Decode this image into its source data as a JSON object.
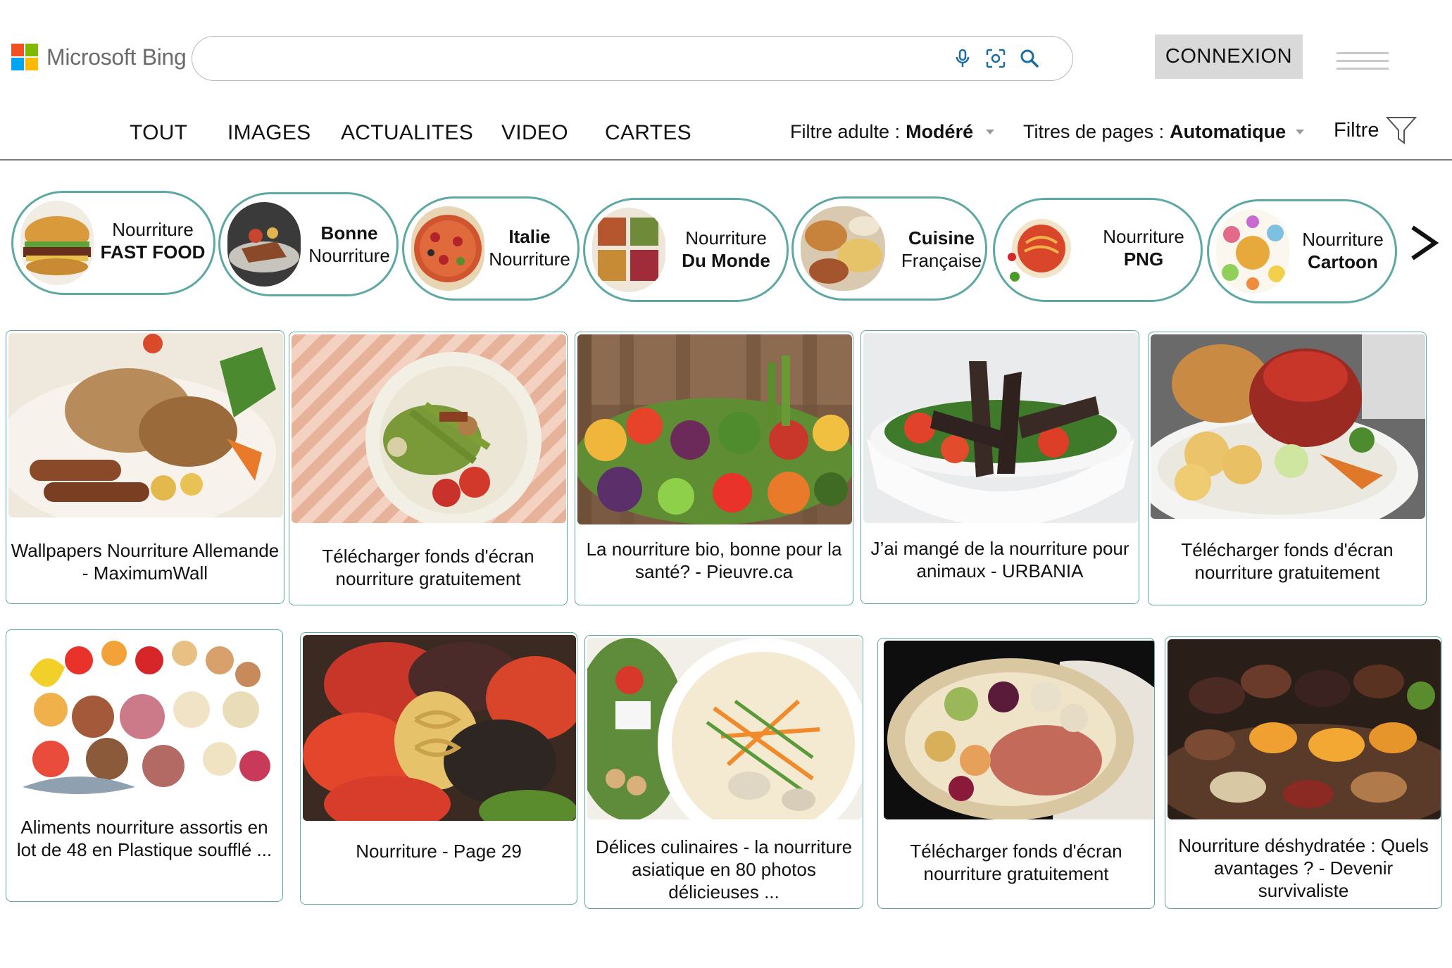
{
  "brand": {
    "logo_text": "Microsoft Bing",
    "colors": {
      "red": "#f25022",
      "green": "#7fba00",
      "blue": "#00a4ef",
      "yellow": "#ffb900"
    }
  },
  "search": {
    "query": "",
    "placeholder": "",
    "mic_icon": "microphone-icon",
    "visual_icon": "visual-search-icon",
    "search_icon": "search-icon",
    "icon_color": "#1a6fa0"
  },
  "header": {
    "connexion_label": "CONNEXION",
    "menu_icon": "hamburger-menu-icon"
  },
  "tabs": [
    {
      "label": "TOUT"
    },
    {
      "label": "IMAGES"
    },
    {
      "label": "ACTUALITES"
    },
    {
      "label": "VIDEO"
    },
    {
      "label": "CARTES"
    }
  ],
  "filters": {
    "adult_label": "Filtre adulte :",
    "adult_value": "Modéré",
    "page_titles_label": "Titres de pages :",
    "page_titles_value": "Automatique",
    "filter_label": "Filtre",
    "filter_icon": "funnel-icon"
  },
  "related_searches": [
    {
      "line1": "Nourriture",
      "line2": "FAST FOOD",
      "bold_line": 2
    },
    {
      "line1": "Bonne",
      "line2": "Nourriture",
      "bold_line": 1
    },
    {
      "line1": "Italie",
      "line2": "Nourriture",
      "bold_line": 1
    },
    {
      "line1": "Nourriture",
      "line2": "Du Monde",
      "bold_line": 2
    },
    {
      "line1": "Cuisine",
      "line2": "Française",
      "bold_line": 1
    },
    {
      "line1": "Nourriture",
      "line2": "PNG",
      "bold_line": 2
    },
    {
      "line1": "Nourriture",
      "line2": "Cartoon",
      "bold_line": 2
    }
  ],
  "next_icon": "chevron-right-icon",
  "results_row1": [
    {
      "caption": "Wallpapers Nourriture Allemande - MaximumWall"
    },
    {
      "caption": "Télécharger fonds d'écran nourriture gratuitement"
    },
    {
      "caption": "La nourriture bio, bonne pour la santé? - Pieuvre.ca"
    },
    {
      "caption": "J’ai mangé de la nourriture pour animaux - URBANIA"
    },
    {
      "caption": "Télécharger fonds d'écran nourriture gratuitement"
    }
  ],
  "results_row2": [
    {
      "caption": "Aliments nourriture assortis en lot de 48 en Plastique soufflé ..."
    },
    {
      "caption": "Nourriture - Page 29"
    },
    {
      "caption": "Délices culinaires - la nourriture asiatique en 80 photos délicieuses ..."
    },
    {
      "caption": "Télécharger fonds d'écran nourriture gratuitement"
    },
    {
      "caption": "Nourriture déshydratée : Quels avantages ? - Devenir survivaliste"
    }
  ]
}
